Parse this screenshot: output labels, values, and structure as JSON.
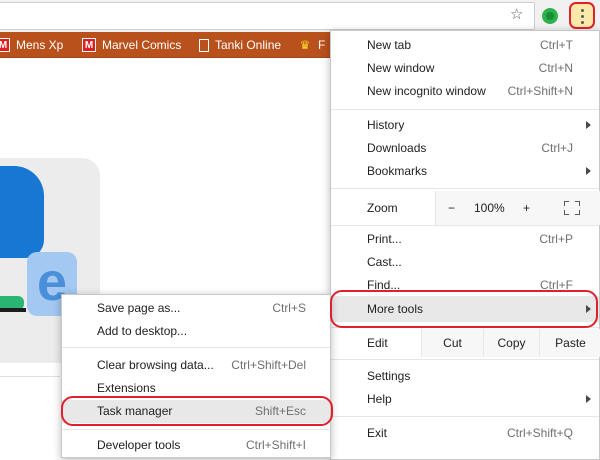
{
  "toolbar": {
    "star_glyph": "☆",
    "ext_icon_color": "#2bb24c",
    "menu_button_icon": "kebab-menu-icon"
  },
  "bookmarks": [
    {
      "label": "Mens Xp",
      "icon": "m-icon"
    },
    {
      "label": "Marvel Comics",
      "icon": "marvel-icon"
    },
    {
      "label": "Tanki Online",
      "icon": "page-icon"
    },
    {
      "label": "F",
      "icon": "crown-icon"
    }
  ],
  "bookmarks_bar_color": "#b8511c",
  "main_menu": {
    "new_tab": {
      "label": "New tab",
      "shortcut": "Ctrl+T"
    },
    "new_window": {
      "label": "New window",
      "shortcut": "Ctrl+N"
    },
    "new_incognito": {
      "label": "New incognito window",
      "shortcut": "Ctrl+Shift+N"
    },
    "history": {
      "label": "History"
    },
    "downloads": {
      "label": "Downloads",
      "shortcut": "Ctrl+J"
    },
    "bookmarks": {
      "label": "Bookmarks"
    },
    "zoom": {
      "label": "Zoom",
      "minus": "−",
      "level": "100%",
      "plus": "+"
    },
    "print": {
      "label": "Print...",
      "shortcut": "Ctrl+P"
    },
    "cast": {
      "label": "Cast..."
    },
    "find": {
      "label": "Find...",
      "shortcut": "Ctrl+F"
    },
    "more_tools": {
      "label": "More tools"
    },
    "edit": {
      "label": "Edit",
      "cut": "Cut",
      "copy": "Copy",
      "paste": "Paste"
    },
    "settings": {
      "label": "Settings"
    },
    "help": {
      "label": "Help"
    },
    "exit": {
      "label": "Exit",
      "shortcut": "Ctrl+Shift+Q"
    }
  },
  "more_tools_menu": {
    "save_page": {
      "label": "Save page as...",
      "shortcut": "Ctrl+S"
    },
    "add_desktop": {
      "label": "Add to desktop..."
    },
    "clear_data": {
      "label": "Clear browsing data...",
      "shortcut": "Ctrl+Shift+Del"
    },
    "extensions": {
      "label": "Extensions"
    },
    "task_manager": {
      "label": "Task manager",
      "shortcut": "Shift+Esc"
    },
    "dev_tools": {
      "label": "Developer tools",
      "shortcut": "Ctrl+Shift+I"
    }
  },
  "highlight_color": "#e0202a"
}
